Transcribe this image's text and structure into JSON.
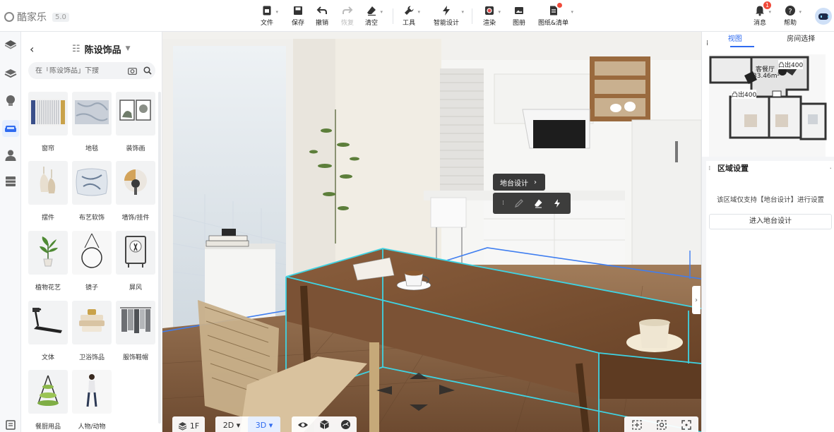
{
  "app": {
    "name": "酷家乐",
    "version": "5.0"
  },
  "toolbar": {
    "file": "文件",
    "save": "保存",
    "undo": "撤销",
    "redo": "恢复",
    "clear": "清空",
    "tools": "工具",
    "smart_design": "智能设计",
    "render": "渲染",
    "album": "图册",
    "drawings": "图纸&清单",
    "messages": "消息",
    "messages_count": "1",
    "help": "帮助"
  },
  "catalog": {
    "title": "陈设饰品",
    "search_placeholder": "在「陈设饰品」下搜",
    "items": [
      {
        "label": "窗帘",
        "icon": "curtain-icon"
      },
      {
        "label": "地毯",
        "icon": "rug-icon"
      },
      {
        "label": "装饰画",
        "icon": "painting-icon"
      },
      {
        "label": "摆件",
        "icon": "ornament-icon"
      },
      {
        "label": "布艺软饰",
        "icon": "cushion-icon"
      },
      {
        "label": "墙饰/挂件",
        "icon": "wall-decor-icon"
      },
      {
        "label": "植物花艺",
        "icon": "plant-icon"
      },
      {
        "label": "镜子",
        "icon": "mirror-icon"
      },
      {
        "label": "屏风",
        "icon": "screen-icon"
      },
      {
        "label": "文体",
        "icon": "treadmill-icon"
      },
      {
        "label": "卫浴饰品",
        "icon": "towel-icon"
      },
      {
        "label": "服饰鞋帽",
        "icon": "clothes-icon"
      },
      {
        "label": "餐厨用品",
        "icon": "fruit-stand-icon"
      },
      {
        "label": "人物/动物",
        "icon": "person-icon"
      }
    ]
  },
  "viewport": {
    "context_label": "地台设计",
    "floor": "1F",
    "mode_2d": "2D",
    "mode_3d": "3D",
    "active_mode": "3D"
  },
  "minimap": {
    "tab_view": "视图",
    "tab_room": "房间选择",
    "room_label": "客餐厅",
    "room_area": "33.46m²",
    "bay1": "凸出400",
    "bay2": "凸出400"
  },
  "area_settings": {
    "title": "区域设置",
    "note": "该区域仅支持【地台设计】进行设置",
    "button": "进入地台设计"
  },
  "colors": {
    "accent": "#2f6bf0",
    "selection": "#3fd3e3",
    "table_wood": "#7a5236"
  }
}
